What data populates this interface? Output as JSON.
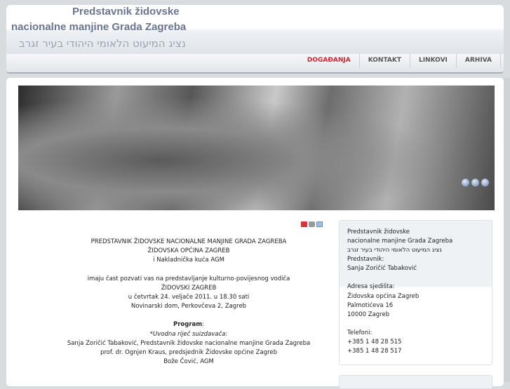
{
  "header": {
    "title_line1": "Predstavnik židovske",
    "title_line2": "nacionalne manjine Grada Zagreba",
    "title_hebrew": "נציג המיעוט הלאומי היהודי בעיר זגרב"
  },
  "nav": [
    {
      "label": "DOGAĐANJA",
      "active": true
    },
    {
      "label": "KONTAKT"
    },
    {
      "label": "LINKOVI"
    },
    {
      "label": "ARHIVA"
    }
  ],
  "colors": {
    "accent": "#d1262a",
    "title": "#6b7590"
  },
  "article": {
    "l1": "PREDSTAVNIK ŽIDOVSKE NACIONALNE MANJINE GRADA ZAGREBA",
    "l2": "ŽIDOVSKA OPĆINA ZAGREB",
    "l3": "i Nakladnička kuća AGM",
    "l4": "imaju čast pozvati vas na predstavljanje kulturno-povijesnog vodiča",
    "l5": "ŽIDOVSKI ZAGREB",
    "l6": "u četvrtak 24. veljače 2011. u 18.30 sati",
    "l7": "Novinarski dom, Perkovčeva 2, Zagreb",
    "program": "Program",
    "colon": ":",
    "l8": "*Uvodna riječ suizdavača:",
    "l9": "Sanja Zoričić Tabaković, Predstavnik židovske nacionalne manjine Grada Zagreba",
    "l10": "prof. dr. Ognjen Kraus, predsjednik Židovske općine Zagreb",
    "l11": "Bože Čović, AGM"
  },
  "sidebar": {
    "lines": [
      "Predstavnik židovske",
      "nacionalne manjine Grada Zagreba",
      "נציג המיעוט הלאומי היהודי בעיר זגרב",
      "Predstavnik:",
      "Sanja Zoričić Tabaković"
    ],
    "address_label": "Adresa sjedišta:",
    "address": [
      "Židovska općina Zagreb",
      "Palmotićeva 16",
      "10000 Zagreb"
    ],
    "phones_label": "Telefoni:",
    "phones": [
      "+385 1 48 28 515",
      "+385 1 48 28 517"
    ]
  }
}
